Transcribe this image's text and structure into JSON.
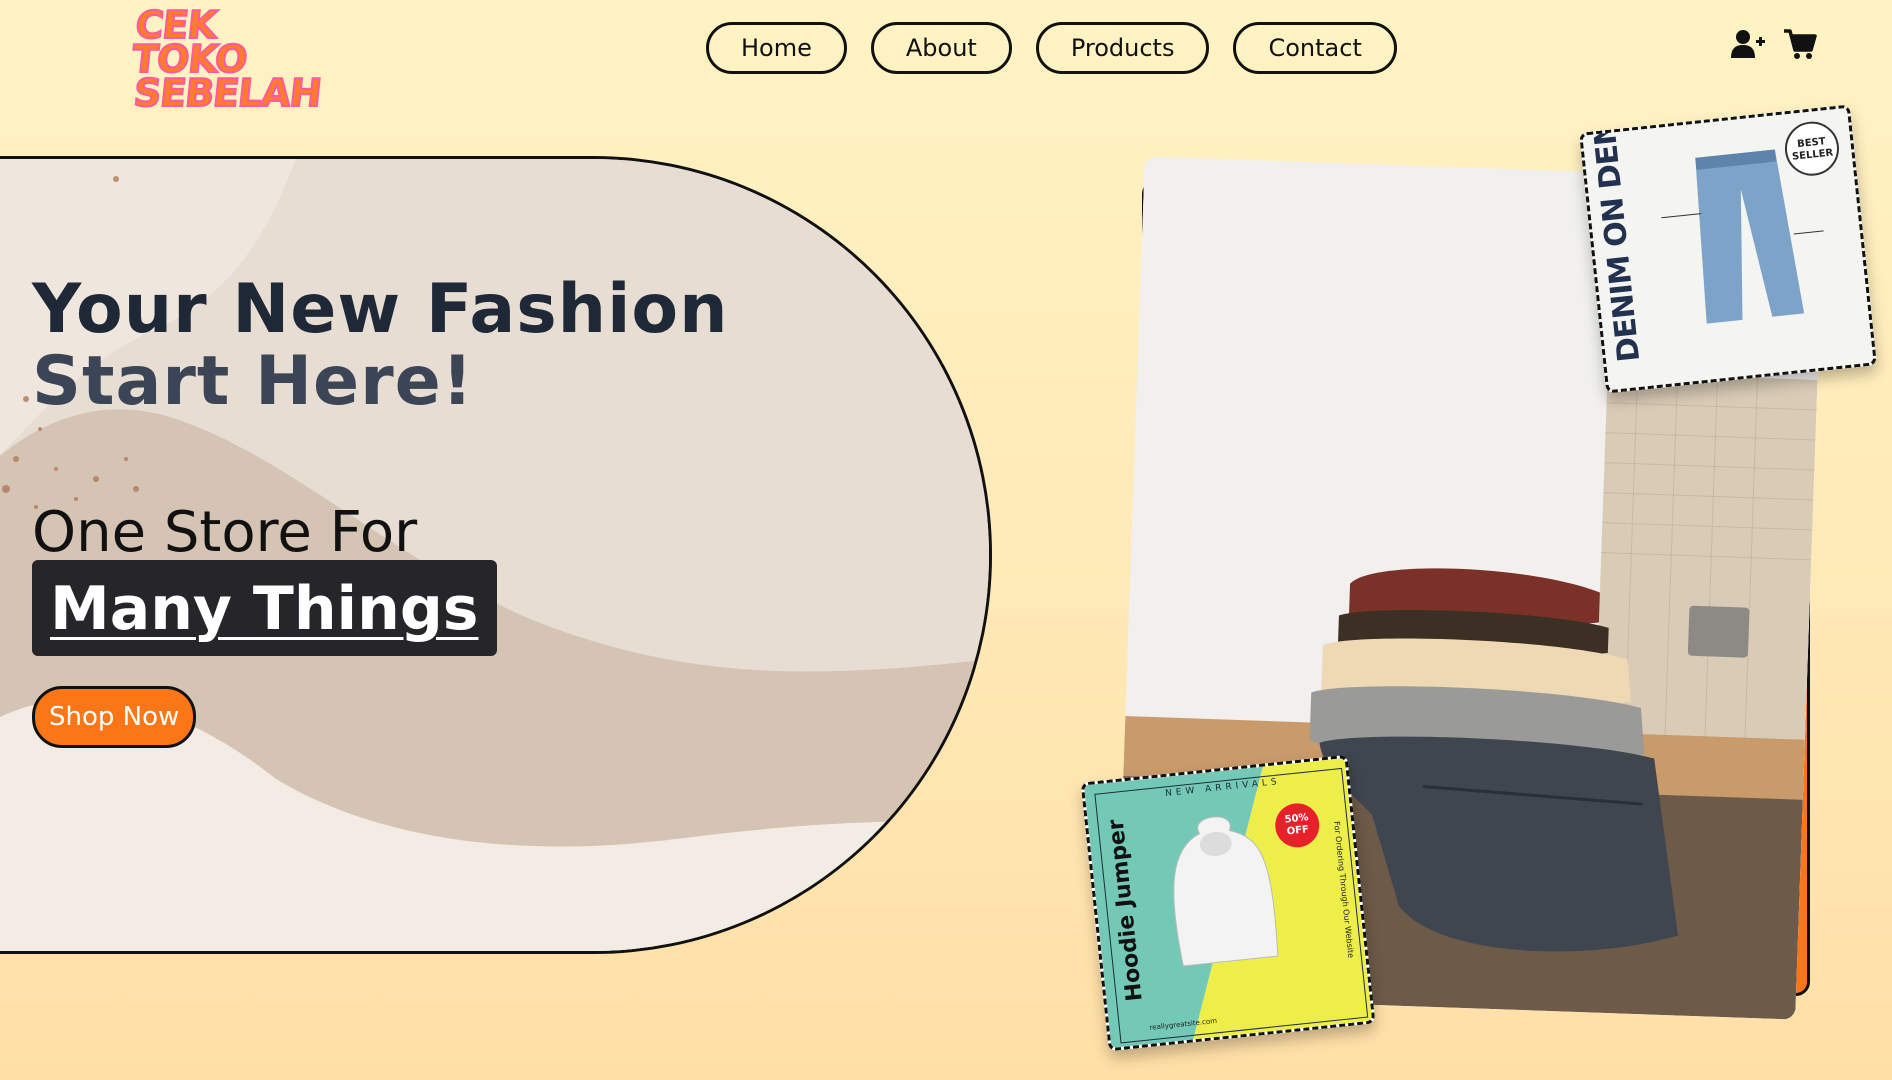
{
  "brand": {
    "logo_line1": "CEK TOKO",
    "logo_line2": "SEBELAH"
  },
  "nav": {
    "items": [
      "Home",
      "About",
      "Products",
      "Contact"
    ]
  },
  "header_icons": {
    "account": "user-plus-icon",
    "cart": "shopping-cart-icon"
  },
  "hero": {
    "title_line1": "Your New Fashion",
    "title_line2": "Start Here!",
    "tagline": "One Store For",
    "highlight": "Many Things",
    "cta": "Shop Now"
  },
  "cards": {
    "denim": {
      "title": "DENIM ON DENIM",
      "badge_line1": "BEST",
      "badge_line2": "SELLER"
    },
    "hoodie": {
      "title": "Hoodie Jumper",
      "label": "NEW ARRIVALS",
      "discount_line1": "50%",
      "discount_line2": "OFF",
      "order_note": "For Ordering Through Our Website",
      "site": "reallygreatsite.com"
    }
  },
  "colors": {
    "accent": "#fb7617",
    "text_dark": "#1f2837",
    "background": "#fff3c4",
    "highlight_bg": "#26262a"
  }
}
